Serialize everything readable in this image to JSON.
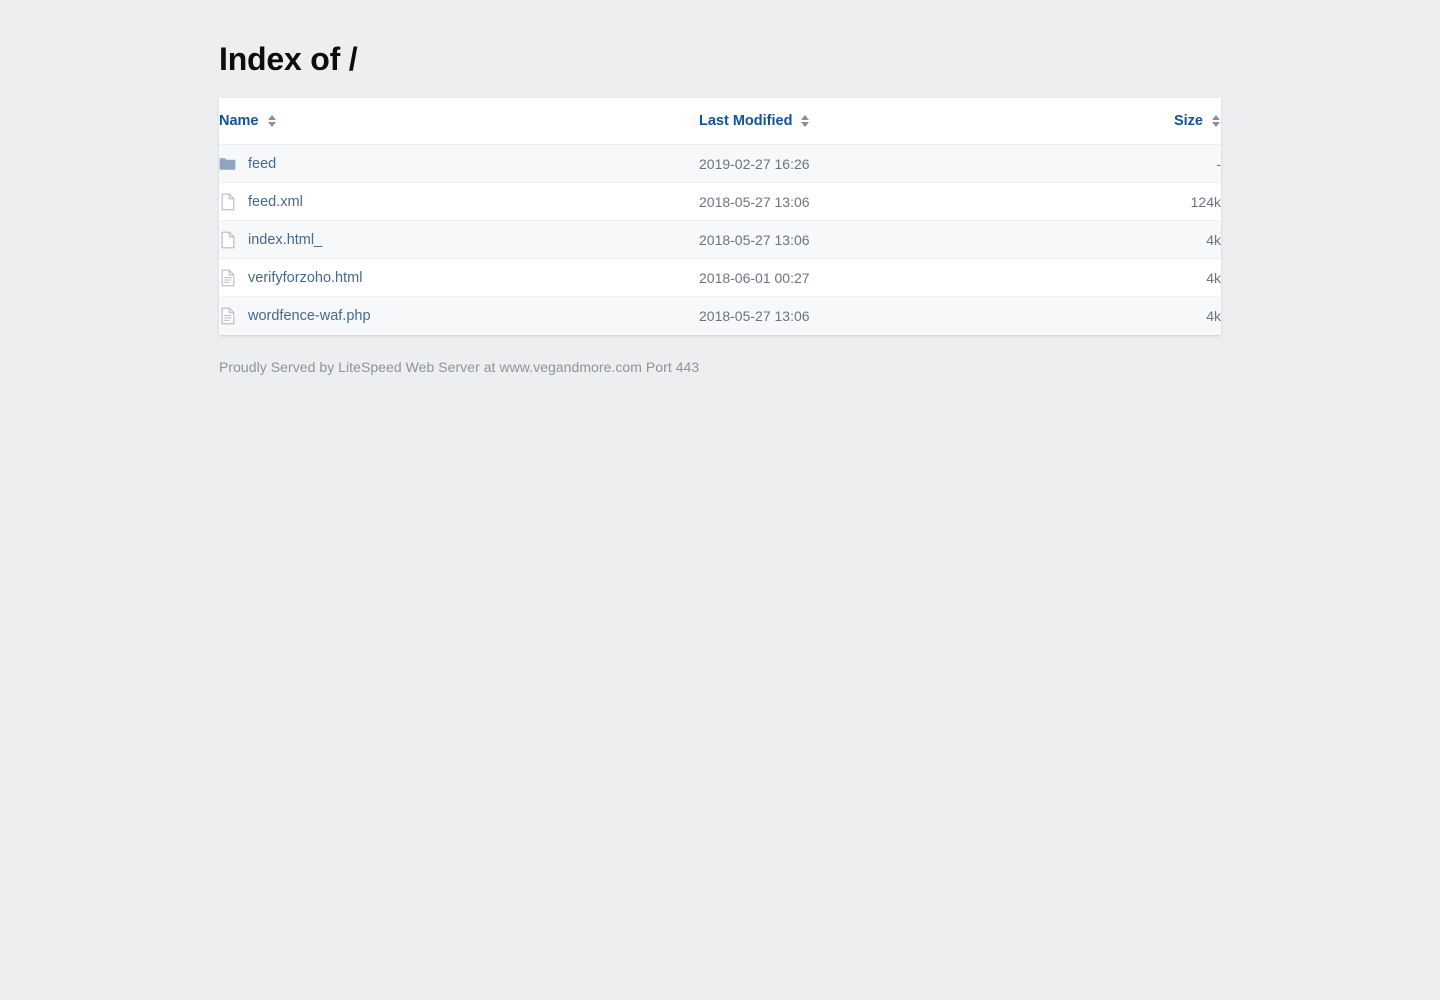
{
  "page": {
    "title": "Index of /",
    "background_color": "#eceef0"
  },
  "colors": {
    "header_link": "#11529c",
    "file_link": "#46698e",
    "folder_icon": "#8fa4c0",
    "file_icon": "#b6bcc4",
    "text_muted": "#6b7480",
    "footer_text": "#8d949c",
    "row_odd": "#f6f8fa",
    "row_even": "#ffffff"
  },
  "table": {
    "columns": [
      {
        "key": "name",
        "label": "Name",
        "sort_icon": "sort-updown-icon",
        "align": "left"
      },
      {
        "key": "date",
        "label": "Last Modified",
        "sort_icon": "sort-updown-icon",
        "align": "left"
      },
      {
        "key": "size",
        "label": "Size",
        "sort_icon": "sort-updown-icon",
        "align": "right"
      }
    ],
    "rows": [
      {
        "icon": "folder-icon",
        "name": "feed",
        "date": "2019-02-27 16:26",
        "size": "-"
      },
      {
        "icon": "file-icon",
        "name": "feed.xml",
        "date": "2018-05-27 13:06",
        "size": "124k"
      },
      {
        "icon": "file-icon",
        "name": "index.html_",
        "date": "2018-05-27 13:06",
        "size": "4k"
      },
      {
        "icon": "document-icon",
        "name": "verifyforzoho.html",
        "date": "2018-06-01 00:27",
        "size": "4k"
      },
      {
        "icon": "document-icon",
        "name": "wordfence-waf.php",
        "date": "2018-05-27 13:06",
        "size": "4k"
      }
    ]
  },
  "footer": {
    "text": "Proudly Served by LiteSpeed Web Server at www.vegandmore.com Port 443"
  }
}
